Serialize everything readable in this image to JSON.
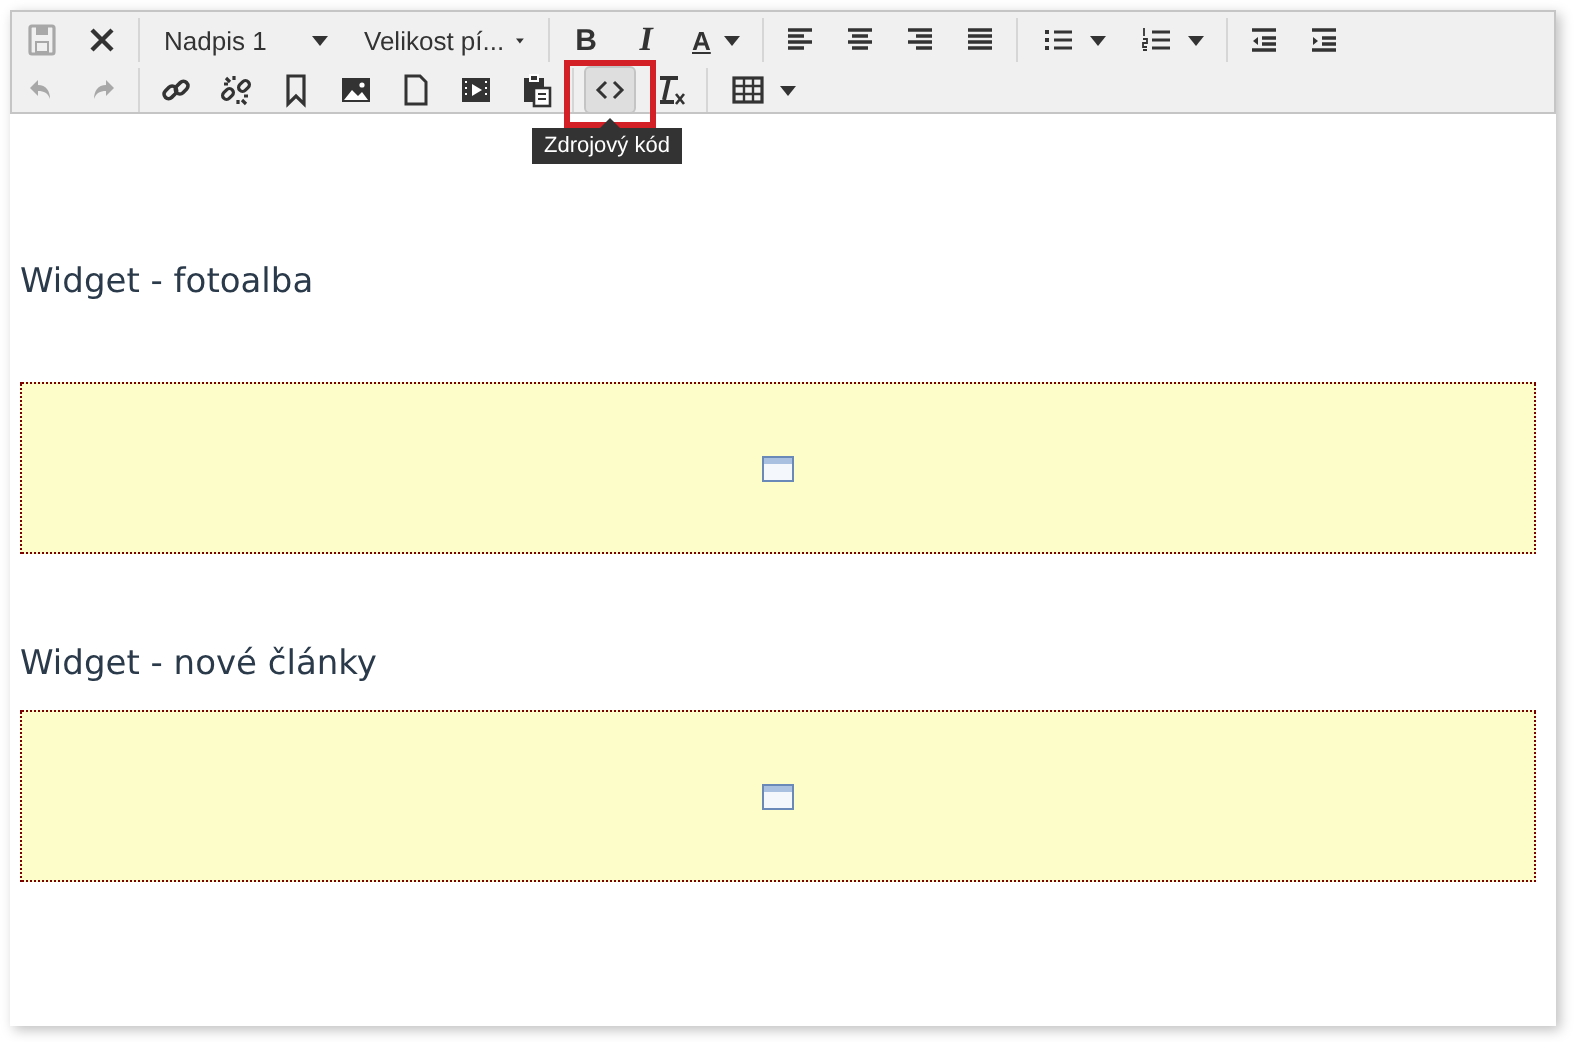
{
  "toolbar": {
    "rows": [
      {
        "items": [
          {
            "kind": "button",
            "disabled": true
          },
          {
            "kind": "button",
            "disabled": false
          },
          {
            "kind": "separator"
          },
          {
            "kind": "select",
            "label": "Nadpis 1"
          },
          {
            "kind": "select",
            "label": "Velikost pí..."
          },
          {
            "kind": "separator"
          },
          {
            "kind": "bold",
            "glyph": "B"
          },
          {
            "kind": "italic",
            "glyph": "I"
          },
          {
            "kind": "split-glyph",
            "glyph": "A"
          },
          {
            "kind": "separator"
          },
          {
            "kind": "button",
            "disabled": false
          },
          {
            "kind": "button",
            "disabled": false
          },
          {
            "kind": "button",
            "disabled": false
          },
          {
            "kind": "button",
            "disabled": false
          },
          {
            "kind": "separator"
          },
          {
            "kind": "split"
          },
          {
            "kind": "split"
          },
          {
            "kind": "separator"
          },
          {
            "kind": "button",
            "disabled": false
          },
          {
            "kind": "button",
            "disabled": false
          }
        ]
      },
      {
        "items": [
          {
            "kind": "button",
            "disabled": true
          },
          {
            "kind": "button",
            "disabled": true
          },
          {
            "kind": "separator"
          },
          {
            "kind": "button",
            "disabled": false
          },
          {
            "kind": "button",
            "disabled": false
          },
          {
            "kind": "button",
            "disabled": false
          },
          {
            "kind": "button",
            "disabled": false
          },
          {
            "kind": "button",
            "disabled": false
          },
          {
            "kind": "button",
            "disabled": false
          },
          {
            "kind": "button",
            "disabled": false
          },
          {
            "kind": "separator"
          },
          {
            "kind": "button",
            "disabled": false,
            "active": true,
            "highlighted": true,
            "tooltip": "Zdrojový kód"
          },
          {
            "kind": "button",
            "disabled": false
          },
          {
            "kind": "separator"
          },
          {
            "kind": "split"
          }
        ]
      }
    ]
  },
  "content": [
    {
      "kind": "heading",
      "text": "Widget - fotoalba"
    },
    {
      "kind": "widget"
    },
    {
      "kind": "heading",
      "text": "Widget - nové články"
    },
    {
      "kind": "widget"
    }
  ]
}
